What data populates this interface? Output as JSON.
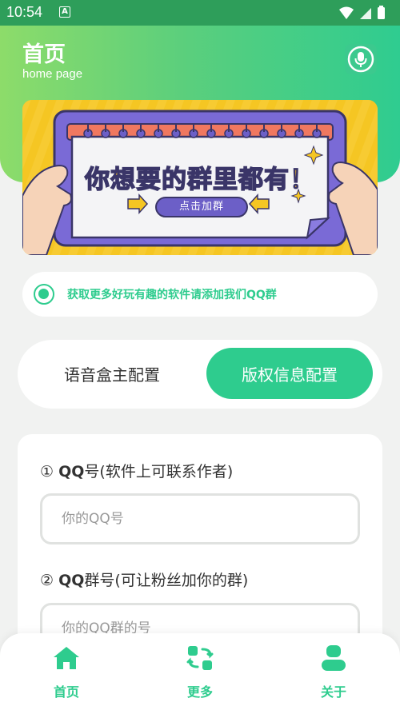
{
  "status_bar": {
    "time": "10:54",
    "app_icon_letter": "A"
  },
  "header": {
    "title": "首页",
    "subtitle": "home page",
    "mic_icon": "microphone-icon"
  },
  "banner": {
    "headline": "你想要的群里都有！",
    "button_label": "点击加群"
  },
  "notice": {
    "text": "获取更多好玩有趣的软件请添加我们QQ群"
  },
  "tabs": [
    {
      "label": "语音盒主配置",
      "active": false
    },
    {
      "label": "版权信息配置",
      "active": true
    }
  ],
  "form": {
    "qq_label_num": "①",
    "qq_label_bold": "QQ",
    "qq_label_rest": "号(软件上可联系作者)",
    "qq_placeholder": "你的QQ号",
    "group_label_num": "②",
    "group_label_bold": "QQ",
    "group_label_rest": "群号(可让粉丝加你的群)",
    "group_placeholder": "你的QQ群的号"
  },
  "bottom_nav": [
    {
      "label": "首页",
      "icon": "home-icon"
    },
    {
      "label": "更多",
      "icon": "swap-icon"
    },
    {
      "label": "关于",
      "icon": "user-icon"
    }
  ],
  "colors": {
    "accent": "#2ecc8e",
    "header_start": "#8ddc6a",
    "header_end": "#2fcc90",
    "banner_bg": "#f5c623",
    "banner_frame": "#6c5fc7"
  }
}
